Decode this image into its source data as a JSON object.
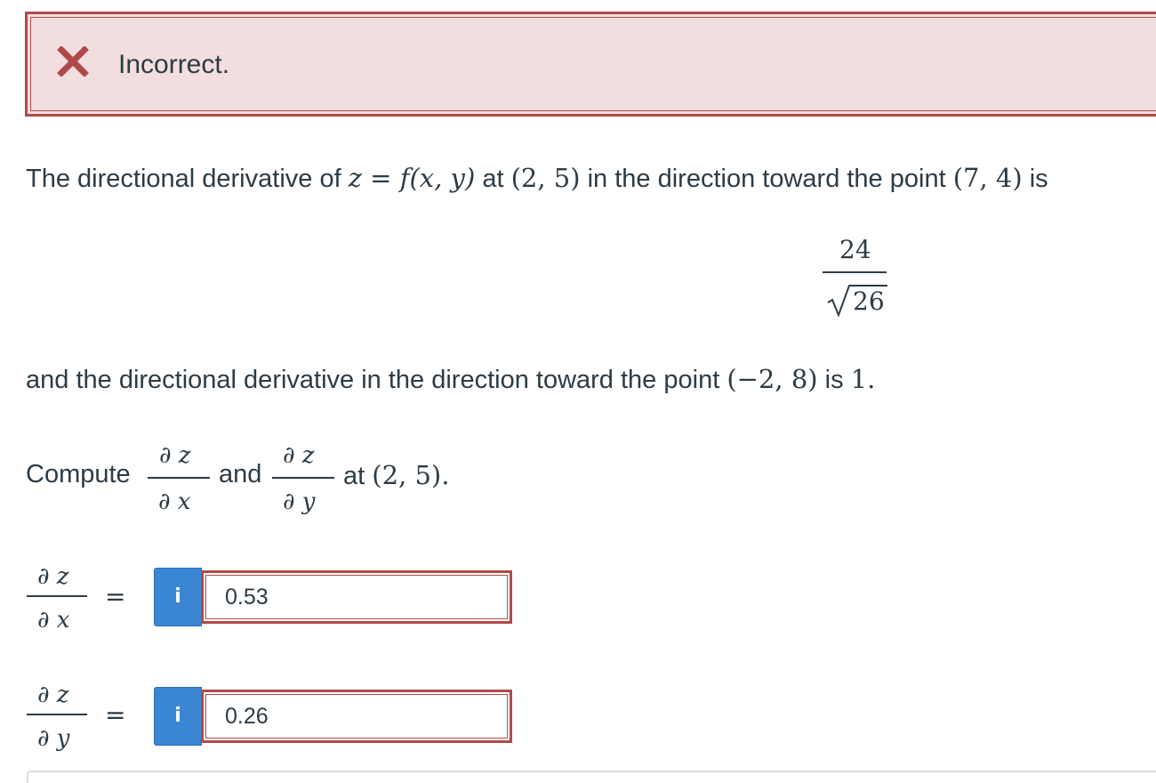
{
  "feedback": {
    "icon": "x-icon",
    "text": "Incorrect.",
    "color": "#b04a4a",
    "background": "#f2dede"
  },
  "problem": {
    "line1": {
      "prefix": "The directional derivative of ",
      "var_z": "z",
      "equals": " = ",
      "func": "f(x, y)",
      "at": " at ",
      "point1": "(2, 5)",
      "middle": " in the direction toward the point ",
      "point2": "(7, 4)",
      "suffix": " is"
    },
    "value1": {
      "numerator": "24",
      "denominator": "26"
    },
    "line2": {
      "prefix": "and the directional derivative in the direction toward the point ",
      "point": "(−2, 8)",
      "is": " is ",
      "value": "1."
    },
    "compute": {
      "word": "Compute",
      "and": "and",
      "at": "at",
      "point": "(2, 5)."
    },
    "partials": {
      "dz": "∂ z",
      "dx": "∂ x",
      "dy": "∂ y"
    }
  },
  "answers": [
    {
      "equals": "=",
      "info_label": "i",
      "value": "0.53"
    },
    {
      "equals": "=",
      "info_label": "i",
      "value": "0.26"
    }
  ]
}
